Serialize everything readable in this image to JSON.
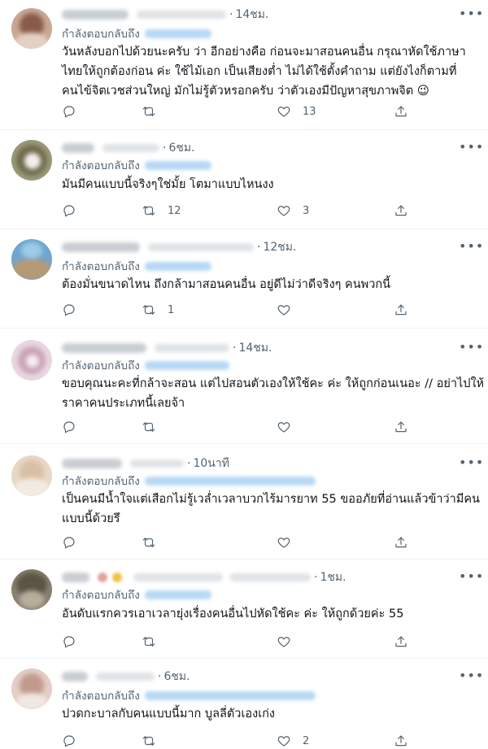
{
  "common": {
    "replying_to": "กำลังตอบกลับถึง",
    "more_glyph": "•••",
    "dot": "·"
  },
  "colors": {
    "text": "#0f1419",
    "secondary": "#536471",
    "divider": "#eff3f4",
    "blurred_handle_link": "#b7d9f5"
  },
  "tweets": [
    {
      "time": "14ชม.",
      "text": "วันหลังบอกไปด้วยนะครับ ว่า อีกอย่างคือ ก่อนจะมาสอนคนอื่น กรุณาหัดใช้ภาษาไทยให้ถูกต้องก่อน ค่ะ ใช้ไม้เอก เป็นเสียงต่ำ ไม่ได้ใช้ตั้งคำถาม แต่ยังไงก็ตามที่คนไข้จิตเวชส่วนใหญ่ มักไม่รู้ตัวหรอกครับ ว่าตัวเองมีปัญหาสุขภาพจิต 😉",
      "retweets": "",
      "likes": "13"
    },
    {
      "time": "6ชม.",
      "text": "มันมีคนแบบนี้จริงๆใช่มั้ย โตมาแบบไหนงง",
      "retweets": "12",
      "likes": "3"
    },
    {
      "time": "12ชม.",
      "text": "ต้องมั่นขนาดไหน ถึงกล้ามาสอนคนอื่น อยู่ดีไม่ว่าดีจริงๆ คนพวกนี้",
      "retweets": "1",
      "likes": ""
    },
    {
      "time": "14ชม.",
      "text": "ขอบคุณนะคะที่กล้าจะสอน แต่ไปสอนตัวเองให้ใช้คะ ค่ะ ให้ถูกก่อนเนอะ // อย่าไปให้ราคาคนประเภทนี้เลยจ้า",
      "retweets": "",
      "likes": ""
    },
    {
      "time": "10นาที",
      "text": "เป็นคนมีน้ำใจแต่เสือกไม่รู้เวล่ำเวลาบวกไร้มารยาท 55 ขออภัยที่อ่านแล้วข้าว่ามีคนแบบนี้ด้วยรึ",
      "retweets": "",
      "likes": ""
    },
    {
      "time": "1ชม.",
      "text": "อันดับแรกควรเอาเวลายุ่งเรื่องคนอื่นไปหัดใช้คะ ค่ะ ให้ถูกด้วยค่ะ 55",
      "retweets": "",
      "likes": ""
    },
    {
      "time": "6ชม.",
      "text": "ปวดกะบาลกับคนแบบนี้มาก บูลลี่ตัวเองเก่ง",
      "retweets": "",
      "likes": "2"
    }
  ]
}
